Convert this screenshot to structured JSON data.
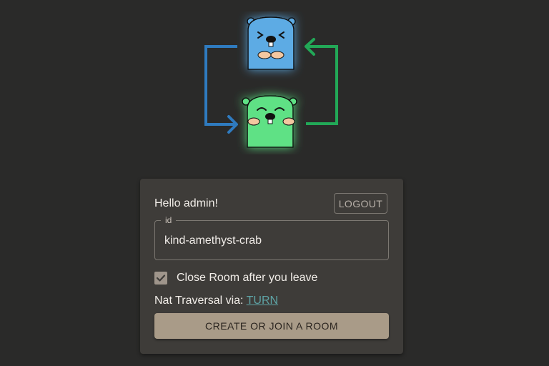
{
  "header": {
    "logo_icon": "gopher-peer-exchange-logo-icon"
  },
  "card": {
    "greeting": "Hello admin!",
    "logout_label": "LOGOUT",
    "id_field": {
      "label": "id",
      "value": "kind-amethyst-crab"
    },
    "close_room": {
      "label": "Close Room after you leave",
      "checked": true
    },
    "nat": {
      "prefix": "Nat Traversal via: ",
      "link": "TURN"
    },
    "join_label": "CREATE OR JOIN A ROOM"
  },
  "colors": {
    "background": "#2a2a29",
    "card": "#3e3c39",
    "primary_button": "#a99b88",
    "link": "#5ea4a6",
    "blue_gopher": "#5dabe4",
    "green_gopher": "#5ee185",
    "blue_arrow": "#2f7bbf",
    "green_arrow": "#22a857"
  }
}
